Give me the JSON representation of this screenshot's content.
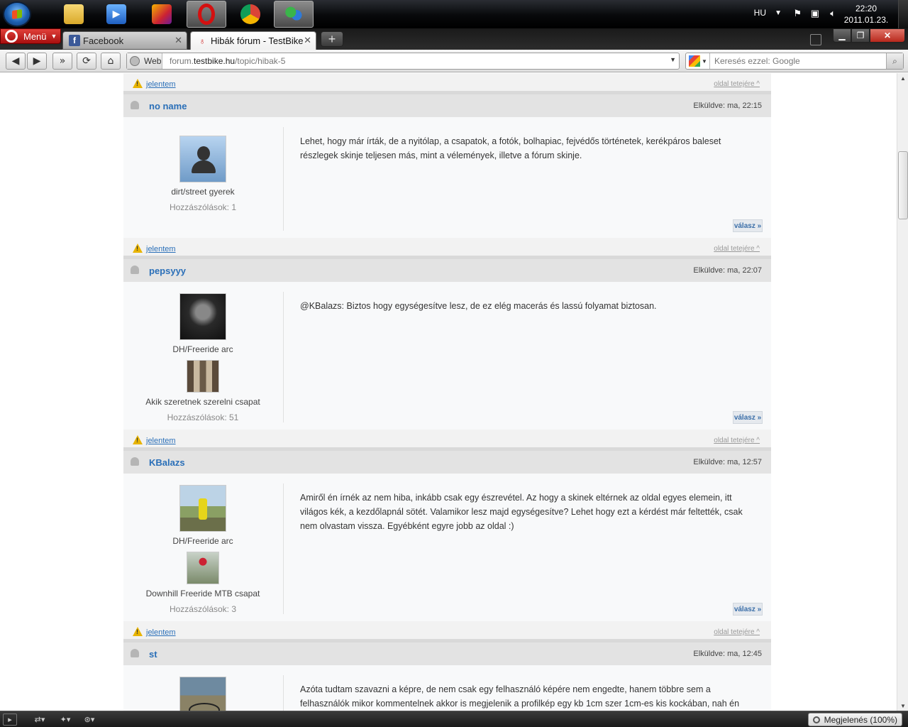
{
  "taskbar": {
    "apps": [
      {
        "name": "explorer",
        "icon": "folder-icon"
      },
      {
        "name": "media-player",
        "icon": "media-player-icon"
      },
      {
        "name": "game",
        "icon": "game-icon"
      },
      {
        "name": "opera",
        "icon": "opera-icon"
      },
      {
        "name": "chrome",
        "icon": "chrome-icon"
      },
      {
        "name": "messenger",
        "icon": "messenger-icon"
      }
    ],
    "language": "HU",
    "time": "22:20",
    "date": "2011.01.23."
  },
  "browser": {
    "menu_label": "Menü",
    "tabs": [
      {
        "label": "Facebook",
        "active": false
      },
      {
        "label": "Hibák fórum - TestBike",
        "active": true
      }
    ],
    "web_label": "Web",
    "url_prefix": "forum.",
    "url_domain": "testbike.hu",
    "url_path": "/topic/hibak-5",
    "search_placeholder": "Keresés ezzel: Google",
    "zoom_label": "Megjelenés (100%)"
  },
  "forum": {
    "report_label": "jelentem",
    "top_label": "oldal tetejére ^",
    "reply_label": "válasz »",
    "posts": [
      {
        "author": "no name",
        "sent": "Elküldve: ma, 22:15",
        "rank": "dirt/street gyerek",
        "team": "",
        "post_count": "Hozzászólások: 1",
        "text": "Lehet, hogy már írták, de a nyitólap, a csapatok, a fotók, bolhapiac, fejvédős történetek, kerékpáros baleset részlegek skinje teljesen más, mint a vélemények, illetve a fórum skinje."
      },
      {
        "author": "pepsyyy",
        "sent": "Elküldve: ma, 22:07",
        "rank": "DH/Freeride arc",
        "team": "Akik szeretnek szerelni csapat",
        "post_count": "Hozzászólások: 51",
        "text": "@KBalazs: Biztos hogy egységesítve lesz, de ez elég macerás és lassú folyamat biztosan."
      },
      {
        "author": "KBalazs",
        "sent": "Elküldve: ma, 12:57",
        "rank": "DH/Freeride arc",
        "team": "Downhill Freeride MTB csapat",
        "post_count": "Hozzászólások: 3",
        "text": "Amiről én írnék az nem hiba, inkább csak egy észrevétel. Az hogy a skinek eltérnek az oldal egyes elemein, itt világos kék, a kezdőlapnál sötét. Valamikor lesz majd egységesítve? Lehet hogy ezt a kérdést már feltették, csak nem olvastam vissza. Egyébként egyre jobb az oldal :)"
      },
      {
        "author": "st",
        "sent": "Elküldve: ma, 12:45",
        "text": "Azóta tudtam szavazni a képre, de nem csak egy felhasználó képére nem engedte, hanem többre sem a felhasználók mikor kommentelnek akkor is megjelenik a profilkép egy kb 1cm szer 1cm-es kis kockában, nah én ezeket a képeket nem láttam, pl. Pepsynél, és olyan is volt több embernél, hogy a th \"ikonját\" (a"
      }
    ]
  }
}
